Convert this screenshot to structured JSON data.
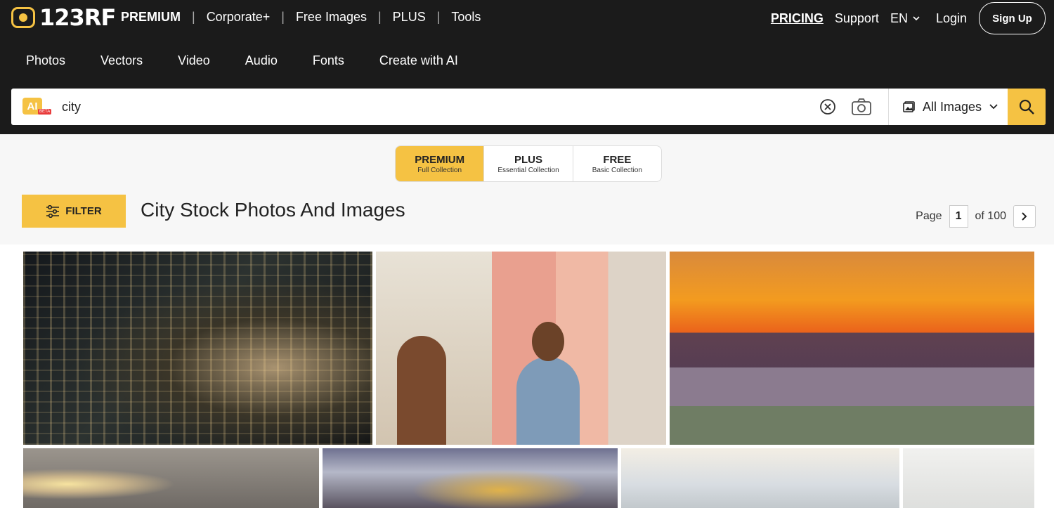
{
  "brand": {
    "logo_text": "123RF"
  },
  "top_nav": {
    "items": [
      "PREMIUM",
      "Corporate+",
      "Free Images",
      "PLUS",
      "Tools"
    ]
  },
  "right_nav": {
    "pricing": "PRICING",
    "support": "Support",
    "language": "EN",
    "login": "Login",
    "signup": "Sign Up"
  },
  "category_nav": [
    "Photos",
    "Vectors",
    "Video",
    "Audio",
    "Fonts",
    "Create with AI"
  ],
  "search": {
    "ai_label": "AI",
    "ai_beta": "BETA",
    "query": "city",
    "type_selected": "All Images"
  },
  "collections": [
    {
      "title": "PREMIUM",
      "subtitle": "Full Collection",
      "active": true
    },
    {
      "title": "PLUS",
      "subtitle": "Essential Collection",
      "active": false
    },
    {
      "title": "FREE",
      "subtitle": "Basic Collection",
      "active": false
    }
  ],
  "filter_label": "FILTER",
  "page_title": "City Stock Photos And Images",
  "pagination": {
    "label": "Page",
    "current": "1",
    "total_label": "of 100"
  },
  "colors": {
    "accent": "#f5c243",
    "header_bg": "#1b1b1b"
  },
  "icons": [
    "logo-camera-icon",
    "chevron-down-icon",
    "clear-circle-icon",
    "camera-icon",
    "image-icon",
    "search-icon",
    "filter-sliders-icon",
    "chevron-right-icon"
  ]
}
